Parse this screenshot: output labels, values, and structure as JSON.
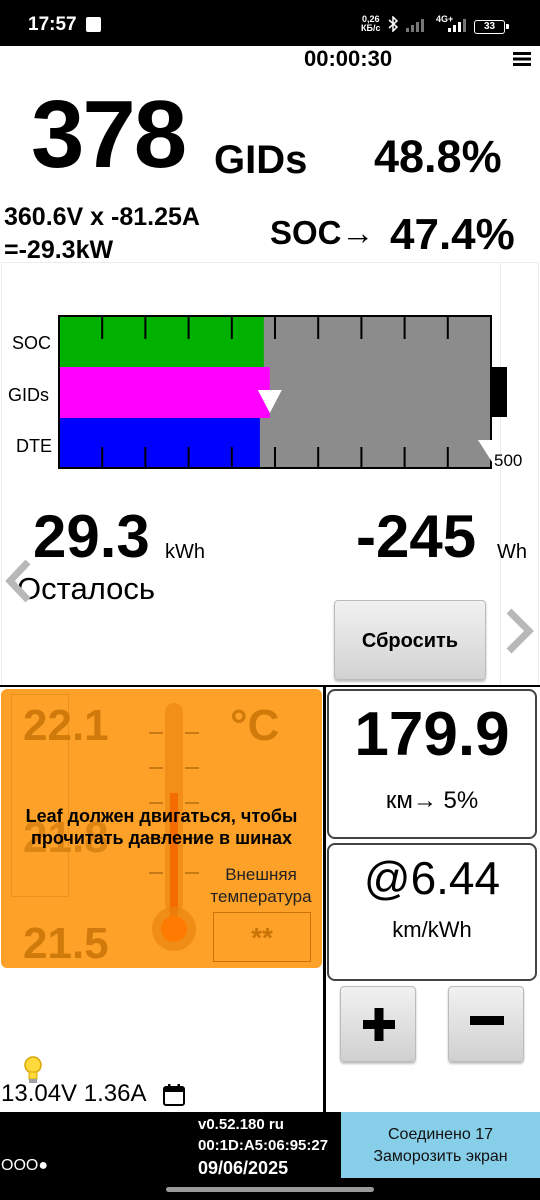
{
  "status_bar": {
    "time": "17:57",
    "net_speed_value": "0,26",
    "net_speed_unit": "КБ/с",
    "network_type": "4G+",
    "battery_level": "33"
  },
  "header": {
    "timer": "00:00:30",
    "menu_icon": "hamburger-menu-icon"
  },
  "gids": {
    "value": "378",
    "unit": "GIDs",
    "percent": "48.8%"
  },
  "electrical": {
    "voltage_current": "360.6V x -81.25A",
    "power": "=-29.3kW"
  },
  "soc": {
    "label": "SOC→",
    "percent": "47.4%"
  },
  "bar_chart": {
    "labels": {
      "soc": "SOC",
      "gids": "GIDs",
      "dte": "DTE"
    },
    "scale_max_label": "500",
    "soc_fraction": 0.474,
    "gids_fraction": 0.488,
    "dte_fraction": 0.465,
    "colors": {
      "soc": "#00b100",
      "gids": "#ff00ff",
      "dte": "#0000ff",
      "empty": "#8c8c8c"
    }
  },
  "energy": {
    "remaining_value": "29.3",
    "remaining_unit": "kWh",
    "remaining_label": "Осталось",
    "used_value": "-245",
    "used_unit": "Wh",
    "reset_button": "Сбросить"
  },
  "temperature": {
    "high": "22.1",
    "unit": "°C",
    "mid": "21.8",
    "low": "21.5",
    "tire_warning": "Leaf должен двигаться, чтобы прочитать давление в шинах",
    "outside_label": "Внешняя температура",
    "outside_value": "**",
    "panel_color": "#fda129"
  },
  "range": {
    "value": "179.9",
    "unit_text": "км→ 5%",
    "efficiency_value": "@6.44",
    "efficiency_unit": "km/kWh"
  },
  "aux_battery": {
    "text": "13.04V 1.36A"
  },
  "footer": {
    "version": "v0.52.180 ru",
    "mac": "00:1D:A5:06:95:27",
    "date": "09/06/2025",
    "conn_indicator": "OOO●",
    "connect_line1": "Соединено 17",
    "connect_line2": "Заморозить экран",
    "connect_color": "#87cee8"
  }
}
